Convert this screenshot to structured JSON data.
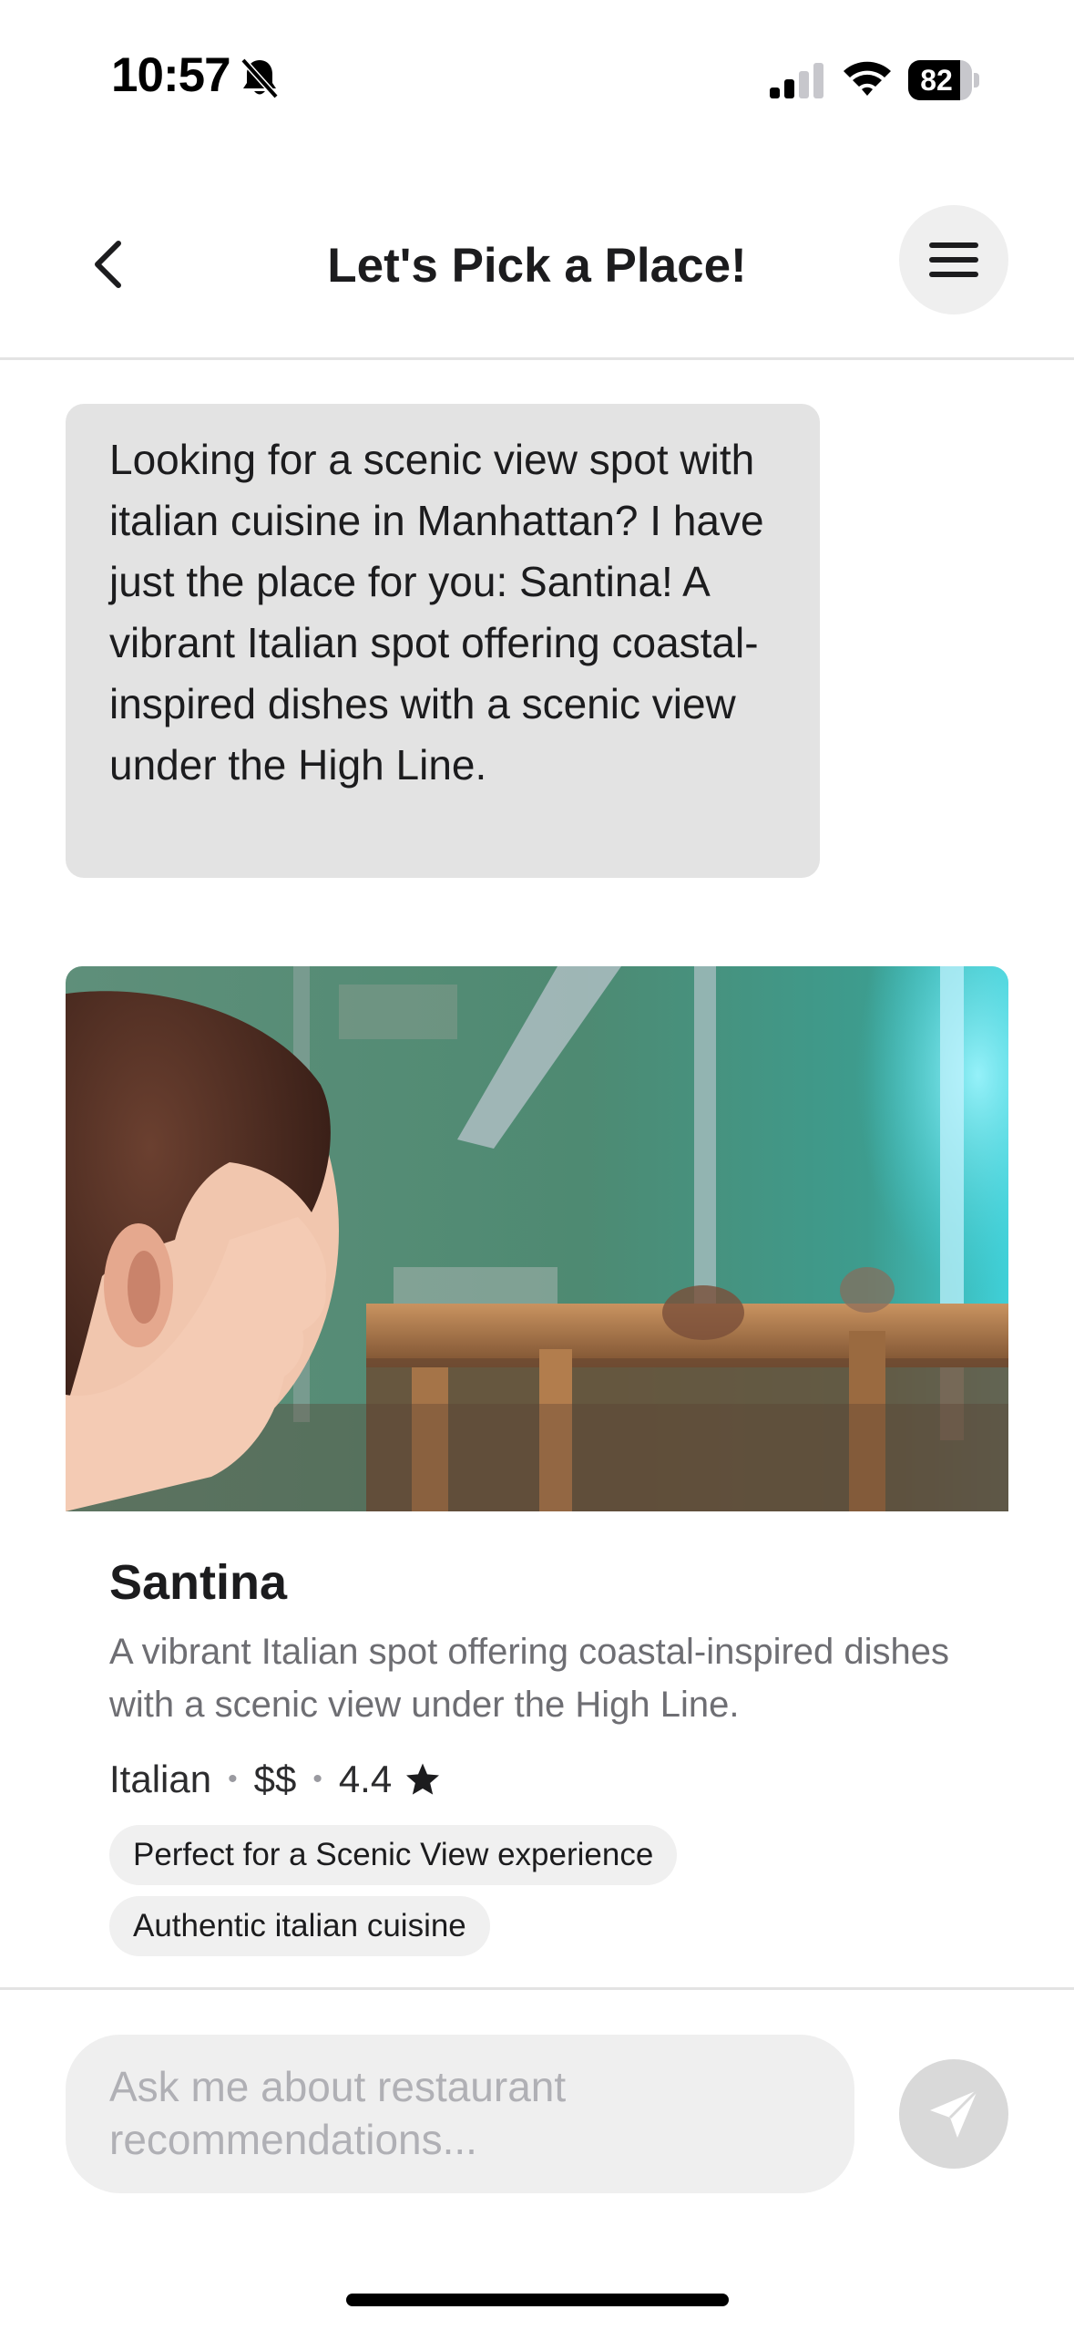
{
  "status_bar": {
    "time": "10:57",
    "battery_percent": 82,
    "battery_label": "82",
    "icons": [
      "bell-slash-icon",
      "cellular-signal-icon",
      "wifi-icon",
      "battery-icon"
    ]
  },
  "header": {
    "title": "Let's Pick a Place!",
    "back_icon": "chevron-left-icon",
    "menu_icon": "hamburger-menu-icon"
  },
  "chat": {
    "assistant_message": "Looking for a scenic view spot with italian cuisine in Manhattan? I have just the place for you: Santina! A vibrant Italian spot offering coastal-inspired dishes with a scenic view under the High Line."
  },
  "restaurant": {
    "name": "Santina",
    "description": "A vibrant Italian spot offering coastal-inspired dishes with a scenic view under the High Line.",
    "cuisine": "Italian",
    "price": "$$",
    "rating": "4.4",
    "rating_icon": "star-icon",
    "tags": [
      "Perfect for a Scenic View experience",
      "Authentic italian cuisine"
    ]
  },
  "composer": {
    "placeholder": "Ask me about restaurant recommendations...",
    "send_icon": "paper-plane-icon"
  },
  "colors": {
    "bubble_bg": "#e3e3e3",
    "input_bg": "#efefef",
    "send_button_bg": "#d9d9d9",
    "muted_text": "#6e6e73"
  }
}
